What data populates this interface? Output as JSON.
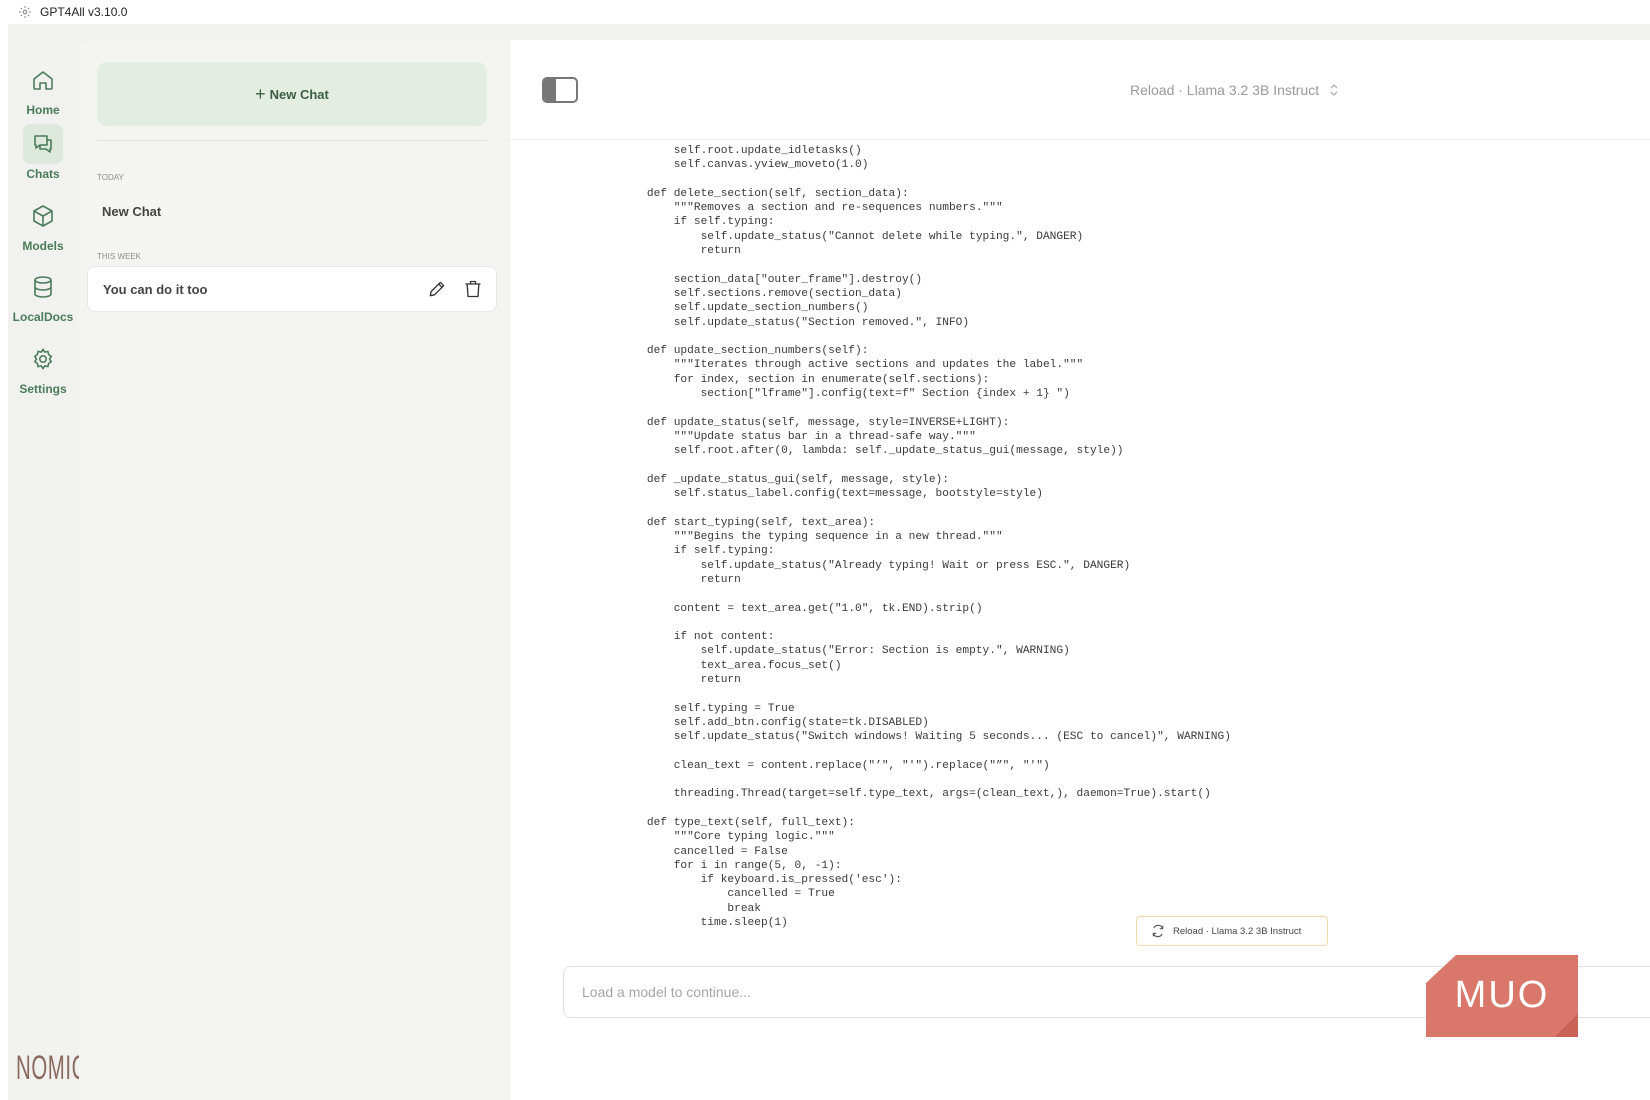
{
  "window": {
    "title": "GPT4All v3.10.0"
  },
  "nav": {
    "items": [
      {
        "label": "Home",
        "icon": "home-icon"
      },
      {
        "label": "Chats",
        "icon": "chat-icon"
      },
      {
        "label": "Models",
        "icon": "cube-icon"
      },
      {
        "label": "LocalDocs",
        "icon": "database-icon"
      },
      {
        "label": "Settings",
        "icon": "gear-icon"
      }
    ],
    "active": "Chats",
    "logo_text": "NOMIC"
  },
  "chat_panel": {
    "new_chat_label": "New Chat",
    "sections": [
      {
        "label": "TODAY",
        "chats": [
          {
            "title": "New Chat"
          }
        ]
      },
      {
        "label": "THIS WEEK",
        "chats": [
          {
            "title": "You can do it too",
            "selected": true
          }
        ]
      }
    ]
  },
  "header": {
    "model_selector": "Reload · Llama 3.2 3B Instruct"
  },
  "conversation": {
    "code_lines": [
      "        self.root.update_idletasks()",
      "        self.canvas.yview_moveto(1.0)",
      "",
      "    def delete_section(self, section_data):",
      "        \"\"\"Removes a section and re-sequences numbers.\"\"\"",
      "        if self.typing:",
      "            self.update_status(\"Cannot delete while typing.\", DANGER)",
      "            return",
      "",
      "        section_data[\"outer_frame\"].destroy()",
      "        self.sections.remove(section_data)",
      "        self.update_section_numbers()",
      "        self.update_status(\"Section removed.\", INFO)",
      "",
      "    def update_section_numbers(self):",
      "        \"\"\"Iterates through active sections and updates the label.\"\"\"",
      "        for index, section in enumerate(self.sections):",
      "            section[\"lframe\"].config(text=f\" Section {index + 1} \")",
      "",
      "    def update_status(self, message, style=INVERSE+LIGHT):",
      "        \"\"\"Update status bar in a thread-safe way.\"\"\"",
      "        self.root.after(0, lambda: self._update_status_gui(message, style))",
      "",
      "    def _update_status_gui(self, message, style):",
      "        self.status_label.config(text=message, bootstyle=style)",
      "",
      "    def start_typing(self, text_area):",
      "        \"\"\"Begins the typing sequence in a new thread.\"\"\"",
      "        if self.typing:",
      "            self.update_status(\"Already typing! Wait or press ESC.\", DANGER)",
      "            return",
      "",
      "        content = text_area.get(\"1.0\", tk.END).strip()",
      "",
      "        if not content:",
      "            self.update_status(\"Error: Section is empty.\", WARNING)",
      "            text_area.focus_set()",
      "            return",
      "",
      "        self.typing = True",
      "        self.add_btn.config(state=tk.DISABLED)",
      "        self.update_status(\"Switch windows! Waiting 5 seconds... (ESC to cancel)\", WARNING)",
      "",
      "        clean_text = content.replace(\"’\", \"'\").replace(\"”\", \"'\")",
      "",
      "        threading.Thread(target=self.type_text, args=(clean_text,), daemon=True).start()",
      "",
      "    def type_text(self, full_text):",
      "        \"\"\"Core typing logic.\"\"\"",
      "        cancelled = False",
      "        for i in range(5, 0, -1):",
      "            if keyboard.is_pressed('esc'):",
      "                cancelled = True",
      "                break",
      "            time.sleep(1)"
    ],
    "reload_chip_label": "Reload · Llama 3.2 3B Instruct"
  },
  "input": {
    "placeholder": "Load a model to continue...",
    "value": ""
  },
  "watermark": {
    "text": "MUO"
  },
  "colors": {
    "accent": "#4a7c59",
    "accent_bg": "#e3ede1",
    "panel_bg": "#f4f4f2",
    "watermark": "#d9786a"
  }
}
